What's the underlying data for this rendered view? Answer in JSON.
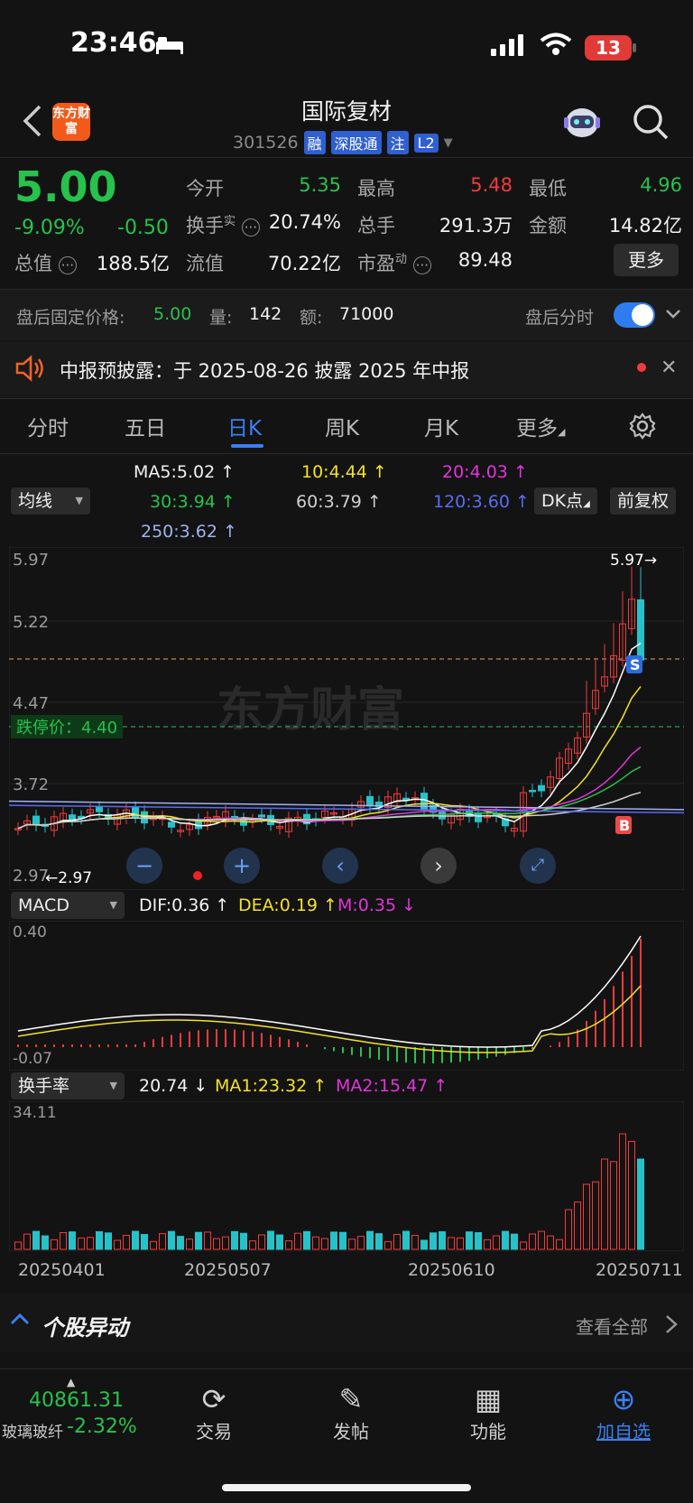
{
  "status_bar": {
    "time": "23:46",
    "battery": "13"
  },
  "header": {
    "title": "国际复材",
    "code": "301526",
    "tags": [
      "融",
      "深股通",
      "注",
      "L2"
    ],
    "logo_text": "东方财富"
  },
  "quote": {
    "price": "5.00",
    "pct": "-9.09%",
    "chg": "-0.50",
    "items": [
      {
        "label": "今开",
        "value": "5.35"
      },
      {
        "label": "最高",
        "value": "5.48"
      },
      {
        "label": "最低",
        "value": "4.96"
      },
      {
        "label": "换手",
        "sup": "实",
        "value": "20.74%"
      },
      {
        "label": "总手",
        "value": "291.3万"
      },
      {
        "label": "金额",
        "value": "14.82亿"
      },
      {
        "label": "总值",
        "value": "188.5亿"
      },
      {
        "label": "流值",
        "value": "70.22亿"
      },
      {
        "label": "市盈",
        "sup": "动",
        "value": "89.48"
      }
    ],
    "more_button": "更多"
  },
  "after_hours": {
    "label": "盘后固定价格:",
    "price": "5.00",
    "vol_label": "量:",
    "vol": "142",
    "amt_label": "额:",
    "amt": "71000",
    "toggle_label": "盘后分时"
  },
  "notice": {
    "text": "中报预披露：于 2025-08-26 披露 2025 年中报"
  },
  "tabs": [
    "分时",
    "五日",
    "日K",
    "周K",
    "月K",
    "更多"
  ],
  "ma_legend": {
    "selector": "均线",
    "ma5": "MA5:5.02 ↑",
    "ma10": "10:4.44 ↑",
    "ma20": "20:4.03 ↑",
    "ma30": "30:3.94 ↑",
    "ma60": "60:3.79 ↑",
    "ma120": "120:3.60 ↑",
    "ma250": "250:3.62 ↑",
    "dk": "DK点",
    "fq": "前复权",
    "colors": {
      "ma5": "#ffffff",
      "ma10": "#f4e12a",
      "ma20": "#e036d9",
      "ma30": "#27c24c",
      "ma60": "#d0d0d0",
      "ma120": "#5a6cf0",
      "ma250": "#9fb3f0"
    }
  },
  "kline": {
    "y_ticks": [
      "5.97",
      "5.22",
      "4.47",
      "3.72",
      "2.97"
    ],
    "high_label": "5.97→",
    "low_label": "←2.97",
    "limit_down_label": "跌停价：4.40",
    "watermark": "东方财富",
    "markers": {
      "sell": "S",
      "buy": "B"
    }
  },
  "macd": {
    "selector": "MACD",
    "dif": "DIF:0.36 ↑",
    "dea": "DEA:0.19 ↑",
    "m": "M:0.35 ↓",
    "top": "0.40",
    "bottom": "-0.07"
  },
  "turnover": {
    "selector": "换手率",
    "value": "20.74 ↓",
    "ma1": "MA1:23.32 ↑",
    "ma2": "MA2:15.47 ↑",
    "top": "34.11"
  },
  "dates": [
    "20250401",
    "20250507",
    "20250610",
    "20250711"
  ],
  "movers": {
    "title": "个股异动",
    "view_all": "查看全部"
  },
  "bottom_bar": {
    "index_value": "40861.31",
    "index_name": "玻璃玻纤",
    "index_pct": "-2.32%",
    "items": [
      "交易",
      "发帖",
      "功能",
      "加自选"
    ]
  },
  "chart_data": {
    "type": "candlestick",
    "x_range": [
      "20250401",
      "20250711"
    ],
    "ylim": [
      2.97,
      5.97
    ],
    "high": 5.97,
    "low": 2.97,
    "last_close": 5.0
  }
}
